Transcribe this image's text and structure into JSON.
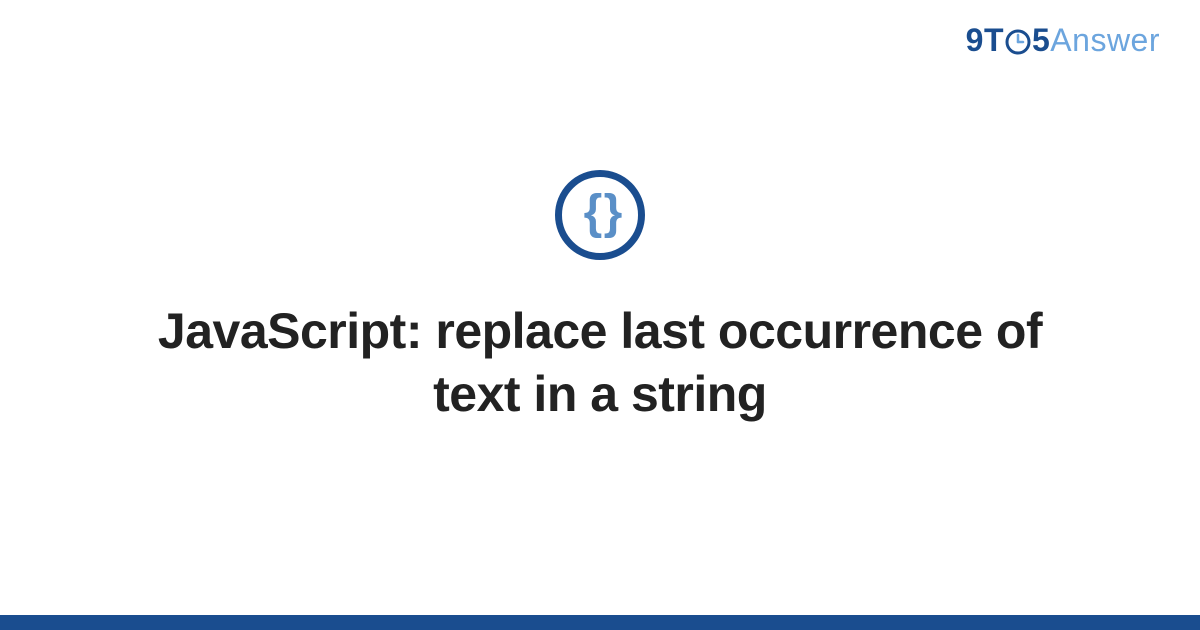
{
  "logo": {
    "part1": "9T",
    "part2": "5",
    "part3": "Answer"
  },
  "icon": {
    "glyph": "{ }",
    "name": "curly-braces-icon"
  },
  "title": "JavaScript: replace last occurrence of text in a string",
  "colors": {
    "primary": "#1a4d8f",
    "accent": "#6ca5de",
    "text": "#222222"
  }
}
